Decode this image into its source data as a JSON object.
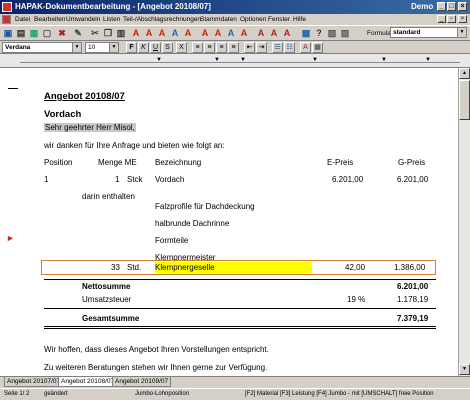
{
  "window": {
    "title": "HAPAK-Dokumentbearbeitung - [Angebot 20108/07]",
    "demo_label": "Demo",
    "minimize": "_",
    "maximize": "□",
    "close": "×"
  },
  "menu": {
    "items": [
      "Datei",
      "Bearbeiten",
      "Umwandeln",
      "Listen",
      "Teil-/Abschlagsrechnungen",
      "Stammdaten",
      "Optionen",
      "Fenster",
      "Hilfe"
    ],
    "mdi_minimize": "_",
    "mdi_restore": "▫",
    "mdi_close": "×"
  },
  "toolbar": {
    "formular_label": "Formular",
    "formular_value": "standard"
  },
  "format": {
    "font_name": "Verdana",
    "font_size": "10",
    "bold": "F",
    "italic": "K",
    "underline": "U",
    "strike": "S",
    "sub": "X",
    "align_left": "≡",
    "align_center": "≡",
    "align_right": "≡",
    "justify": "≡",
    "outdent": "⇤",
    "indent": "⇥"
  },
  "document": {
    "heading": "Angebot 20108/07",
    "subject": "Vordach",
    "salutation": "Sehr geehrter Herr Misol,",
    "intro": "wir danken für Ihre Anfrage und bieten wie folgt an:",
    "columns": {
      "position": "Position",
      "quantity": "Menge ME",
      "description": "Bezeichnung",
      "unit_price": "E-Preis",
      "total_price": "G-Preis"
    },
    "line1": {
      "position": "1",
      "quantity": "1",
      "unit": "Stck",
      "description": "Vordach",
      "unit_price": "6.201,00",
      "total_price": "6.201,00"
    },
    "included_label": "darin enthalten",
    "components": [
      "Falzprofile für Dachdeckung",
      "halbrunde Dachrinne",
      "Formteile",
      "Klempnermeister"
    ],
    "selected_line": {
      "quantity": "33",
      "unit": "Std.",
      "description": "Klempnergeselle",
      "unit_price": "42,00",
      "total_price": "1.386,00"
    },
    "net_label": "Nettosumme",
    "net_value": "6.201,00",
    "vat_label": "Umsatzsteuer",
    "vat_rate": "19 %",
    "vat_value": "1.178,19",
    "total_label": "Gesamtsumme",
    "total_value": "7.379,19",
    "closing1": "Wir hoffen, dass dieses Angebot Ihren Vorstellungen entspricht.",
    "closing2": "Zu weiteren Beratungen stehen wir Ihnen gerne zur Verfügung."
  },
  "doc_tabs": [
    "Angebot 20107/07",
    "Angebot 20108/07",
    "Angebot 20109/07"
  ],
  "status": {
    "page": "Seite 1/ 2",
    "modified": "geändert",
    "mode": "Jumbo-Lohnposition",
    "hints": "[F2] Material  [F3] Leistung  [F4] Jumbo - mit [UMSCHALT] freie Position"
  },
  "colors": {
    "title_start": "#0a246a",
    "title_end": "#3a6ea5",
    "highlight": "#ffff00",
    "selection_border": "#d08030",
    "salutation_bg": "#c8c8c8",
    "marker": "#c03020"
  }
}
